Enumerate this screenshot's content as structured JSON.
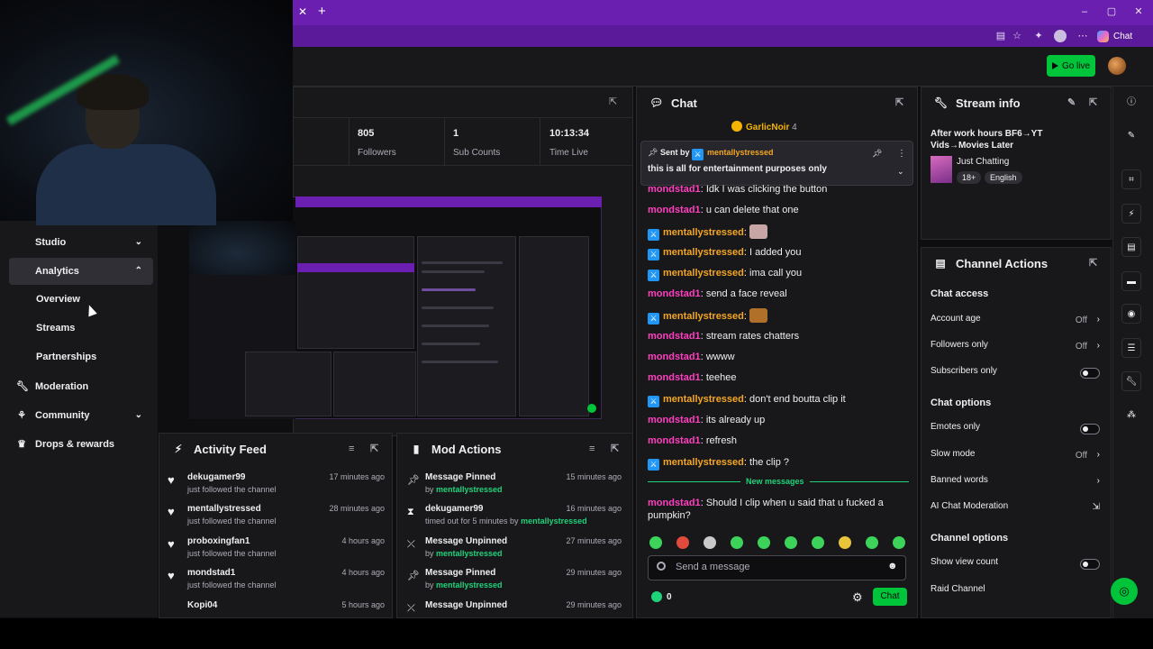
{
  "browser": {
    "tab_close": "✕",
    "new_tab": "+",
    "copilot_label": "Chat",
    "window": {
      "minimize": "–",
      "maximize": "▢",
      "close": "✕"
    }
  },
  "topbar": {
    "go_live_label": "Go live"
  },
  "sidebar": {
    "items": [
      {
        "label": "Studio",
        "icon": "studio-icon",
        "chev": "⌄"
      },
      {
        "label": "Analytics",
        "icon": "analytics-icon",
        "chev": "⌃"
      },
      {
        "label": "Moderation",
        "icon": "wrench-icon"
      },
      {
        "label": "Community",
        "icon": "community-icon",
        "chev": "⌄"
      },
      {
        "label": "Drops & rewards",
        "icon": "drops-icon"
      }
    ],
    "analytics_sub": [
      "Overview",
      "Streams",
      "Partnerships"
    ]
  },
  "stats": [
    {
      "value": "805",
      "label": "Followers"
    },
    {
      "value": "1",
      "label": "Sub Counts"
    },
    {
      "value": "10:13:34",
      "label": "Time Live"
    }
  ],
  "chat": {
    "title": "Chat",
    "top_gifter": "GarlicNoir",
    "top_gifter_count": "4",
    "pinned": {
      "sent_by_prefix": "Sent by",
      "sender": "mentallystressed",
      "text": "this is all for entertainment purposes only"
    },
    "messages": [
      {
        "user": "mondstad1",
        "color": "pink",
        "text": "Idk I was clicking the button"
      },
      {
        "user": "mondstad1",
        "color": "pink",
        "text": "u can delete that one"
      },
      {
        "user": "mentallystressed",
        "color": "gold",
        "badge": true,
        "text": "",
        "emote": true
      },
      {
        "user": "mentallystressed",
        "color": "gold",
        "badge": true,
        "text": "I added you"
      },
      {
        "user": "mentallystressed",
        "color": "gold",
        "badge": true,
        "text": "ima call you"
      },
      {
        "user": "mondstad1",
        "color": "pink",
        "text": "send a face reveal"
      },
      {
        "user": "mentallystressed",
        "color": "gold",
        "badge": true,
        "text": "",
        "emote": true
      },
      {
        "user": "mondstad1",
        "color": "pink",
        "text": "stream rates chatters"
      },
      {
        "user": "mondstad1",
        "color": "pink",
        "text": "wwww"
      },
      {
        "user": "mondstad1",
        "color": "pink",
        "text": "teehee"
      },
      {
        "user": "mentallystressed",
        "color": "gold",
        "badge": true,
        "text": "don't end boutta clip it"
      },
      {
        "user": "mondstad1",
        "color": "pink",
        "text": "its already up"
      },
      {
        "user": "mondstad1",
        "color": "pink",
        "text": "refresh"
      },
      {
        "user": "mentallystressed",
        "color": "gold",
        "badge": true,
        "text": "the clip ?"
      }
    ],
    "new_messages_label": "New messages",
    "last_message": {
      "user": "mondstad1",
      "text": "Should I clip when u said that u fucked a pumpkin?"
    },
    "input_placeholder": "Send a message",
    "points": "0",
    "send_label": "Chat"
  },
  "stream_info": {
    "title": "Stream info",
    "stream_title": "After work hours BF6→YT Vids→Movies Later",
    "category": "Just Chatting",
    "tags": [
      "18+",
      "English"
    ]
  },
  "channel_actions": {
    "title": "Channel Actions",
    "chat_access_heading": "Chat access",
    "account_age": {
      "label": "Account age",
      "value": "Off"
    },
    "followers_only": {
      "label": "Followers only",
      "value": "Off"
    },
    "subscribers_only": {
      "label": "Subscribers only"
    },
    "chat_options_heading": "Chat options",
    "emotes_only": {
      "label": "Emotes only"
    },
    "slow_mode": {
      "label": "Slow mode",
      "value": "Off"
    },
    "banned_words": {
      "label": "Banned words"
    },
    "ai_moderation": {
      "label": "AI Chat Moderation"
    },
    "channel_options_heading": "Channel options",
    "show_view_count": {
      "label": "Show view count"
    },
    "raid_channel": {
      "label": "Raid Channel"
    }
  },
  "activity_feed": {
    "title": "Activity Feed",
    "rows": [
      {
        "name": "dekugamer99",
        "action": "just followed the channel",
        "time": "17 minutes ago"
      },
      {
        "name": "mentallystressed",
        "action": "just followed the channel",
        "time": "28 minutes ago"
      },
      {
        "name": "proboxingfan1",
        "action": "just followed the channel",
        "time": "4 hours ago"
      },
      {
        "name": "mondstad1",
        "action": "just followed the channel",
        "time": "4 hours ago"
      },
      {
        "name": "Kopi04",
        "action": "",
        "time": "5 hours ago"
      }
    ]
  },
  "mod_actions": {
    "title": "Mod Actions",
    "rows": [
      {
        "icon": "pin-icon",
        "title": "Message Pinned",
        "by_prefix": "by ",
        "by": "mentallystressed",
        "time": "15 minutes ago"
      },
      {
        "icon": "timeout-icon",
        "title": "dekugamer99",
        "by_prefix": "timed out for 5 minutes by ",
        "by": "mentallystressed",
        "time": "16 minutes ago"
      },
      {
        "icon": "unpin-icon",
        "title": "Message Unpinned",
        "by_prefix": "by ",
        "by": "mentallystressed",
        "time": "27 minutes ago"
      },
      {
        "icon": "pin-icon",
        "title": "Message Pinned",
        "by_prefix": "by ",
        "by": "mentallystressed",
        "time": "29 minutes ago"
      },
      {
        "icon": "unpin-icon",
        "title": "Message Unpinned",
        "by_prefix": "",
        "by": "",
        "time": "29 minutes ago"
      }
    ]
  },
  "colors": {
    "accent": "#9147ff",
    "go_live": "#00c43a",
    "chat_pink": "#ff3fbf",
    "chat_gold": "#f5a623",
    "new_messages": "#1fd37a"
  }
}
